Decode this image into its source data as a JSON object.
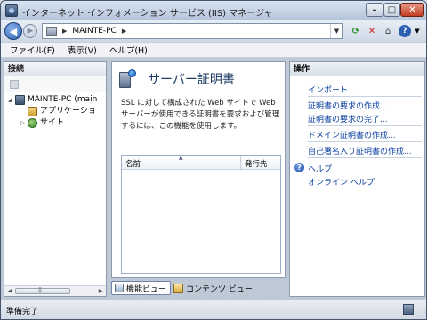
{
  "window": {
    "title": "インターネット インフォメーション サービス (IIS) マネージャ"
  },
  "navbar": {
    "address_value": "MAINTE-PC"
  },
  "menu": {
    "items": [
      "ファイル(F)",
      "表示(V)",
      "ヘルプ(H)"
    ]
  },
  "connections": {
    "header": "接続",
    "tree": [
      {
        "label": "MAINTE-PC (main",
        "icon": "server-icon"
      },
      {
        "label": "アプリケーショ",
        "icon": "application-pool-icon"
      },
      {
        "label": "サイト",
        "icon": "sites-icon"
      }
    ]
  },
  "feature": {
    "title": "サーバー証明書",
    "description": "SSL に対して構成された Web サイトで Web サーバーが使用できる証明書を要求および管理するには、この機能を使用します。",
    "columns": [
      "名前",
      "発行先"
    ]
  },
  "view_tabs": {
    "features_view": "機能ビュー",
    "content_view": "コンテンツ ビュー"
  },
  "actions": {
    "header": "操作",
    "import": "インポート...",
    "create_request": "証明書の要求の作成 ...",
    "complete_request": "証明書の要求の完了...",
    "domain_cert": "ドメイン証明書の作成...",
    "self_signed": "自己署名入り証明書の作成...",
    "help": "ヘルプ",
    "online_help": "オンライン ヘルプ"
  },
  "status": {
    "text": "準備完了"
  },
  "colors": {
    "link": "#0b3f9e",
    "title_text": "#1e3b64"
  }
}
